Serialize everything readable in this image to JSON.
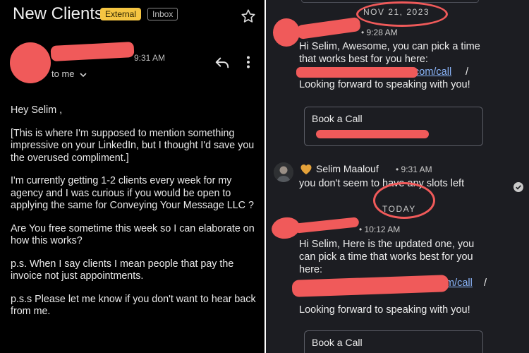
{
  "email": {
    "subject": "New Clients",
    "badge_external": "External",
    "badge_inbox": "Inbox",
    "time": "9:31 AM",
    "to_me": "to me",
    "body": [
      "Hey Selim ,",
      "[This is where I'm supposed to mention something impressive on your LinkedIn, but I thought I'd save you the overused compliment.]",
      "I'm currently getting 1-2 clients every week for my agency and I was curious if you would be open to applying the same for Conveying Your Message LLC ?",
      "Are You free sometime this week so I can elaborate on how this works?",
      "p.s. When I say clients I mean people that pay the invoice not just appointments.",
      "p.s.s Please let me know if you don't want to hear back from me."
    ]
  },
  "chat": {
    "date_1": "NOV 21, 2023",
    "time_1": "• 9:28 AM",
    "msg1_line1": "Hi Selim, Awesome, you can pick a time",
    "msg1_line2": "that works best for you here:",
    "msg1_link": "https://www.calendly.com/call/",
    "msg1_link_visible": "com/call",
    "msg1_line4": "Looking forward to speaking with you!",
    "card_label": "Book a Call",
    "sender_name": "Selim Maalouf",
    "time_2": "• 9:31 AM",
    "msg2": "you don't seem to have any slots left",
    "date_today": "TODAY",
    "time_3": "• 10:12 AM",
    "msg3_line1": "Hi Selim, Here is the updated one, you",
    "msg3_line2": "can pick a time that works best for you",
    "msg3_line3": "here:",
    "msg3_link_visible": "m/call",
    "msg3_line5": "Looking forward to speaking with you!",
    "accent_link": "#8ab4f8",
    "redaction_color": "#f05a5a"
  }
}
